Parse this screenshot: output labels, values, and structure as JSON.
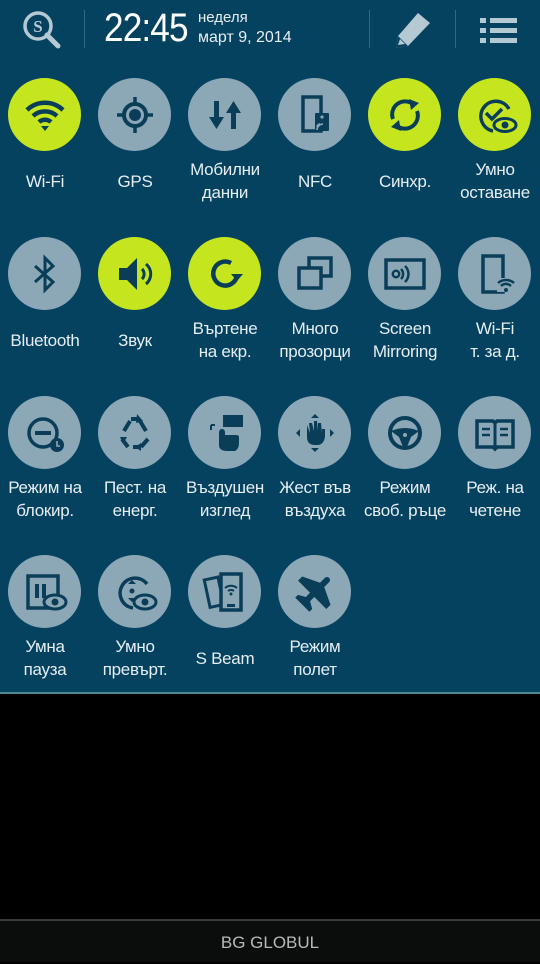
{
  "header": {
    "time": "22:45",
    "day": "неделя",
    "date": "март 9, 2014",
    "icons": {
      "search": "s-finder-icon",
      "edit": "pencil-icon",
      "settings": "list-icon"
    }
  },
  "colors": {
    "panel_bg": "#054260",
    "toggle_on": "#c5e61e",
    "toggle_off": "#8ca8b6",
    "icon_glyph": "#0a3e58",
    "label_text": "#e6eef2"
  },
  "toggles": [
    {
      "line1": "Wi-Fi",
      "line2": "",
      "state": "on",
      "icon": "wifi-icon"
    },
    {
      "line1": "GPS",
      "line2": "",
      "state": "off",
      "icon": "gps-icon"
    },
    {
      "line1": "Мобилни",
      "line2": "данни",
      "state": "off",
      "icon": "mobile-data-icon"
    },
    {
      "line1": "NFC",
      "line2": "",
      "state": "off",
      "icon": "nfc-icon"
    },
    {
      "line1": "Синхр.",
      "line2": "",
      "state": "on",
      "icon": "sync-icon"
    },
    {
      "line1": "Умно",
      "line2": "оставане",
      "state": "on",
      "icon": "smart-stay-icon"
    },
    {
      "line1": "Bluetooth",
      "line2": "",
      "state": "off",
      "icon": "bluetooth-icon"
    },
    {
      "line1": "Звук",
      "line2": "",
      "state": "on",
      "icon": "sound-icon"
    },
    {
      "line1": "Въртене",
      "line2": "на екр.",
      "state": "on",
      "icon": "screen-rotation-icon"
    },
    {
      "line1": "Много",
      "line2": "прозорци",
      "state": "off",
      "icon": "multi-window-icon"
    },
    {
      "line1": "Screen",
      "line2": "Mirroring",
      "state": "off",
      "icon": "screen-mirroring-icon"
    },
    {
      "line1": "Wi-Fi",
      "line2": "т. за д.",
      "state": "off",
      "icon": "wifi-hotspot-icon"
    },
    {
      "line1": "Режим на",
      "line2": "блокир.",
      "state": "off",
      "icon": "blocking-mode-icon"
    },
    {
      "line1": "Пест. на",
      "line2": "енерг.",
      "state": "off",
      "icon": "power-saving-icon"
    },
    {
      "line1": "Въздушен",
      "line2": "изглед",
      "state": "off",
      "icon": "air-view-icon"
    },
    {
      "line1": "Жест във",
      "line2": "въздуха",
      "state": "off",
      "icon": "air-gesture-icon"
    },
    {
      "line1": "Режим",
      "line2": "своб. ръце",
      "state": "off",
      "icon": "hands-free-icon"
    },
    {
      "line1": "Реж. на",
      "line2": "четене",
      "state": "off",
      "icon": "reading-mode-icon"
    },
    {
      "line1": "Умна",
      "line2": "пауза",
      "state": "off",
      "icon": "smart-pause-icon"
    },
    {
      "line1": "Умно",
      "line2": "превърт.",
      "state": "off",
      "icon": "smart-scroll-icon"
    },
    {
      "line1": "S Beam",
      "line2": "",
      "state": "off",
      "icon": "s-beam-icon"
    },
    {
      "line1": "Режим",
      "line2": "полет",
      "state": "off",
      "icon": "airplane-mode-icon"
    }
  ],
  "footer": {
    "carrier": "BG GLOBUL"
  }
}
